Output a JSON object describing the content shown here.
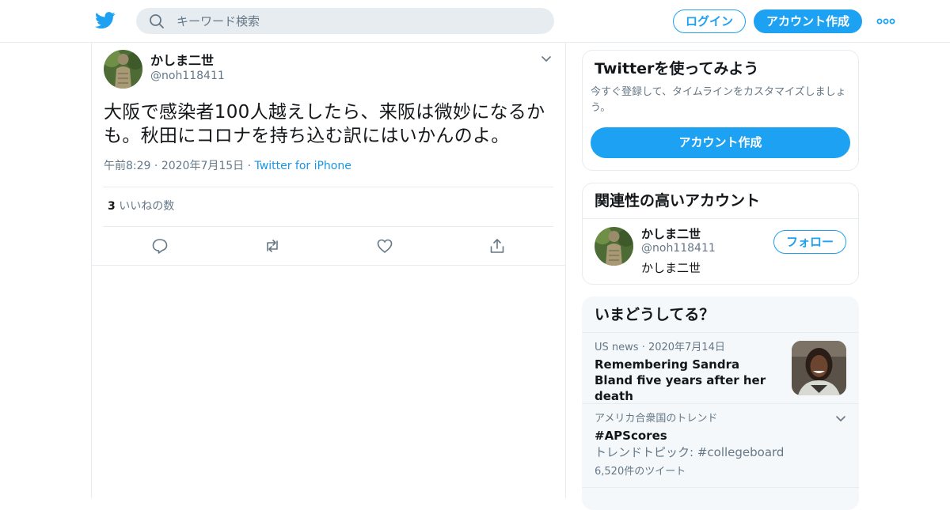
{
  "header": {
    "search_placeholder": "キーワード検索",
    "login_label": "ログイン",
    "signup_label": "アカウント作成",
    "logo_icon": "twitter-bird-icon",
    "more_icon": "more-dots-icon",
    "brand_color": "#1da1f2"
  },
  "tweet": {
    "author_name": "かしま二世",
    "author_handle": "@noh118411",
    "text": "大阪で感染者100人越えしたら、来阪は微妙になるかも。秋田にコロナを持ち込む訳にはいかんのよ。",
    "time": "午前8:29",
    "date": "2020年7月15日",
    "source": "Twitter for iPhone",
    "likes_count": "3",
    "likes_label": "いいねの数",
    "actions": [
      "reply-icon",
      "retweet-icon",
      "like-icon",
      "share-icon"
    ]
  },
  "sidebar": {
    "signup_card": {
      "title": "Twitterを使ってみよう",
      "description": "今すぐ登録して、タイムラインをカスタマイズしましょう。",
      "button": "アカウント作成"
    },
    "related": {
      "title": "関連性の高いアカウント",
      "name": "かしま二世",
      "handle": "@noh118411",
      "bio": "かしま二世",
      "follow_label": "フォロー"
    },
    "happening": {
      "title": "いまどうしてる？",
      "news": {
        "source": "US news",
        "date": "2020年7月14日",
        "headline": "Remembering Sandra Bland five years after her death"
      },
      "trend": {
        "context": "アメリカ合衆国のトレンド",
        "tag": "#APScores",
        "topic": "トレンドトピック: #collegeboard",
        "count": "6,520件のツイート"
      }
    }
  }
}
